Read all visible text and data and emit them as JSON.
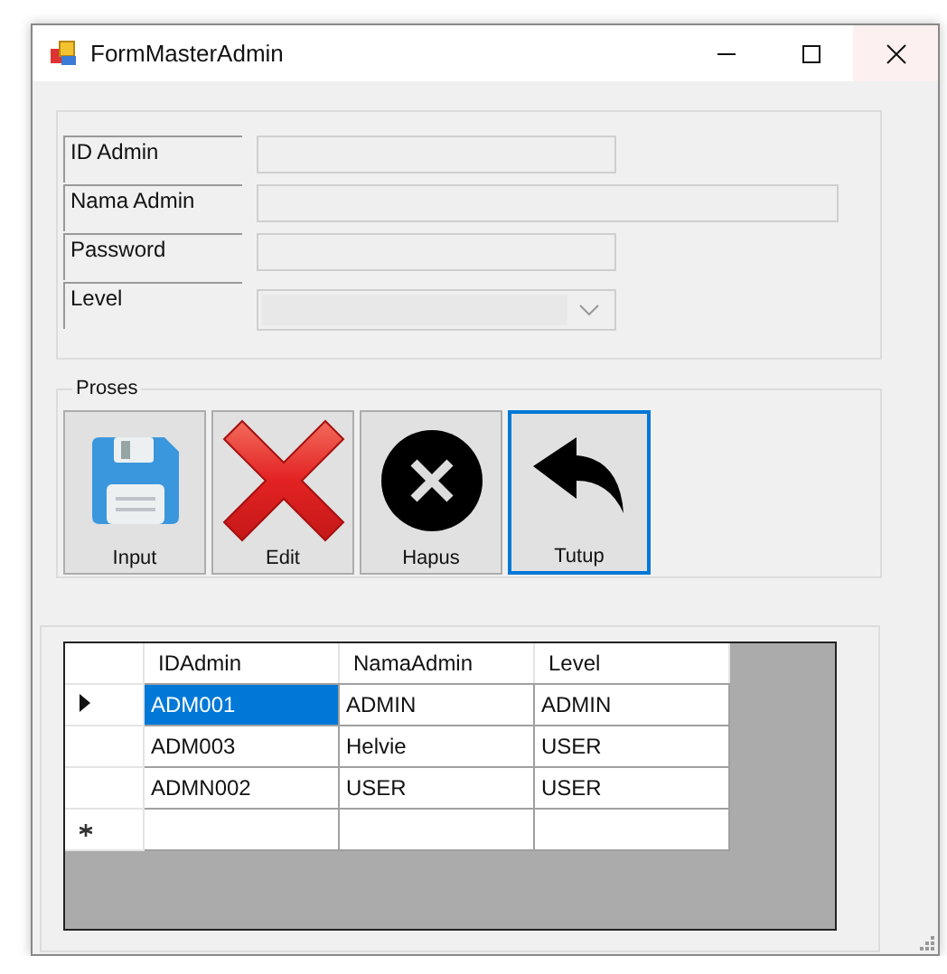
{
  "window": {
    "title": "FormMasterAdmin"
  },
  "form": {
    "fields": [
      {
        "label": "ID Admin",
        "kind": "text"
      },
      {
        "label": "Nama Admin",
        "kind": "wide"
      },
      {
        "label": "Password",
        "kind": "text"
      },
      {
        "label": "Level",
        "kind": "combo"
      }
    ]
  },
  "proses": {
    "title": "Proses",
    "buttons": [
      {
        "label": "Input",
        "focused": false
      },
      {
        "label": "Edit",
        "focused": false
      },
      {
        "label": "Hapus",
        "focused": false
      },
      {
        "label": "Tutup",
        "focused": true
      }
    ]
  },
  "table": {
    "columns": [
      "IDAdmin",
      "NamaAdmin",
      "Level"
    ],
    "rows": [
      {
        "kind": "data",
        "current": true,
        "cells": [
          {
            "text": "ADM001",
            "selected": true
          },
          {
            "text": "ADMIN",
            "selected": false
          },
          {
            "text": "ADMIN",
            "selected": false
          }
        ]
      },
      {
        "kind": "data",
        "current": false,
        "cells": [
          {
            "text": "ADM003",
            "selected": false
          },
          {
            "text": "Helvie",
            "selected": false
          },
          {
            "text": "USER",
            "selected": false
          }
        ]
      },
      {
        "kind": "data",
        "current": false,
        "cells": [
          {
            "text": "ADMN002",
            "selected": false
          },
          {
            "text": "USER",
            "selected": false
          },
          {
            "text": "USER",
            "selected": false
          }
        ]
      },
      {
        "kind": "new",
        "current": false
      }
    ]
  }
}
